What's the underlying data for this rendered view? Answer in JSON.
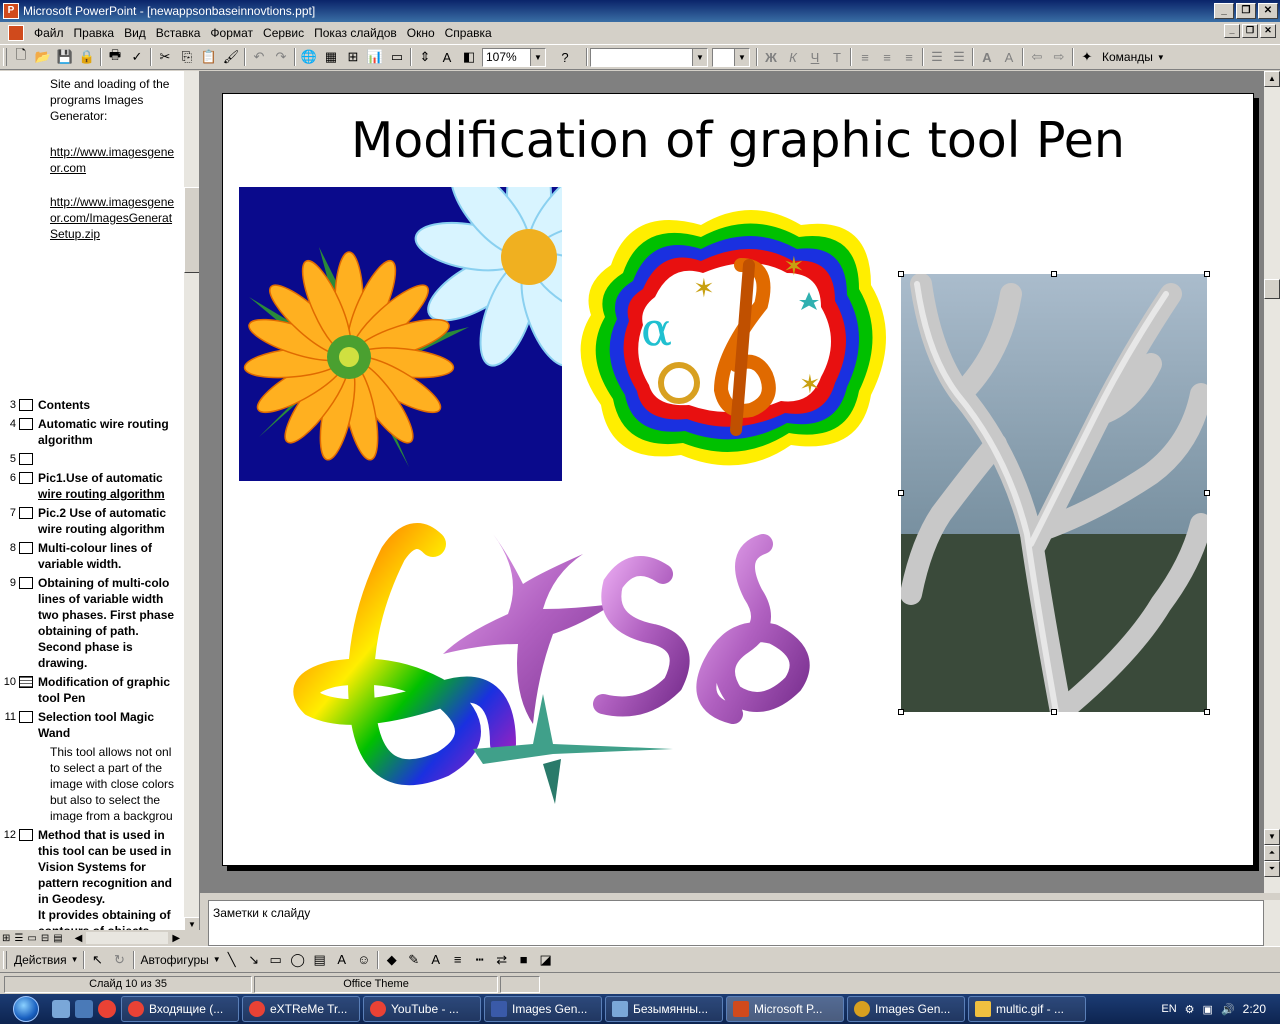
{
  "window": {
    "title": "Microsoft PowerPoint - [newappsonbaseinnovtions.ppt]"
  },
  "menu": [
    "Файл",
    "Правка",
    "Вид",
    "Вставка",
    "Формат",
    "Сервис",
    "Показ слайдов",
    "Окно",
    "Справка"
  ],
  "toolbar": {
    "zoom": "107%",
    "commands_label": "Команды",
    "font_bold": "Ж",
    "font_italic": "К",
    "font_underline": "Ч",
    "font_shadow": "Т"
  },
  "outline": {
    "intro_lines": [
      "Site and loading of the",
      "programs Images",
      "Generator:"
    ],
    "link1": [
      "http://www.imagesgene",
      "or.com"
    ],
    "link2": [
      "http://www.imagesgene",
      "or.com/ImagesGenerat",
      "Setup.zip"
    ],
    "slides": [
      {
        "num": "3",
        "title": [
          "Contents"
        ]
      },
      {
        "num": "4",
        "title": [
          "Automatic wire routing",
          "algorithm"
        ]
      },
      {
        "num": "5",
        "title": [
          ""
        ]
      },
      {
        "num": "6",
        "title": [
          "Pic1.Use of automatic",
          "wire routing algorithm"
        ]
      },
      {
        "num": "7",
        "title": [
          "Pic.2 Use of automatic",
          "wire routing algorithm"
        ]
      },
      {
        "num": "8",
        "title": [
          "Multi-colour lines of",
          "variable width."
        ]
      },
      {
        "num": "9",
        "title": [
          "Obtaining of multi-colo",
          "lines of variable width",
          "two phases. First phase",
          "obtaining of path.",
          "Second phase is",
          "drawing."
        ]
      },
      {
        "num": "10",
        "title": [
          "Modification of graphic",
          "tool Pen"
        ]
      },
      {
        "num": "11",
        "title": [
          "Selection tool Magic",
          "Wand"
        ]
      },
      {
        "num": "12",
        "title": [
          "Method that is used in",
          "this tool can be used in",
          "Vision Systems for",
          "pattern recognition and",
          "in Geodesy.",
          "It provides obtaining of",
          "contours of objects"
        ]
      }
    ],
    "slide11_body": [
      "This tool allows not onl",
      "to select a part of the",
      "image with close colors",
      "but also to select the",
      "image from a backgrou"
    ]
  },
  "slide": {
    "title": "Modification of graphic tool Pen"
  },
  "notes": {
    "placeholder": "Заметки к слайду"
  },
  "drawing": {
    "actions": "Действия",
    "autoshapes": "Автофигуры"
  },
  "status": {
    "slide_counter": "Слайд 10 из 35",
    "theme": "Office Theme"
  },
  "taskbar": {
    "items": [
      {
        "label": "Входящие (...",
        "icon_color": "#e94235"
      },
      {
        "label": "eXTReMe Tr...",
        "icon_color": "#e94235"
      },
      {
        "label": "YouTube - ...",
        "icon_color": "#e94235"
      },
      {
        "label": "Images Gen...",
        "icon_color": "#3a5aa8"
      },
      {
        "label": "Безымянны...",
        "icon_color": "#7aa7d8"
      },
      {
        "label": "Microsoft P...",
        "icon_color": "#d04a1c"
      },
      {
        "label": "Images Gen...",
        "icon_color": "#d8a020"
      },
      {
        "label": "multic.gif - ...",
        "icon_color": "#f0c040"
      }
    ],
    "lang": "EN",
    "clock": "2:20"
  }
}
